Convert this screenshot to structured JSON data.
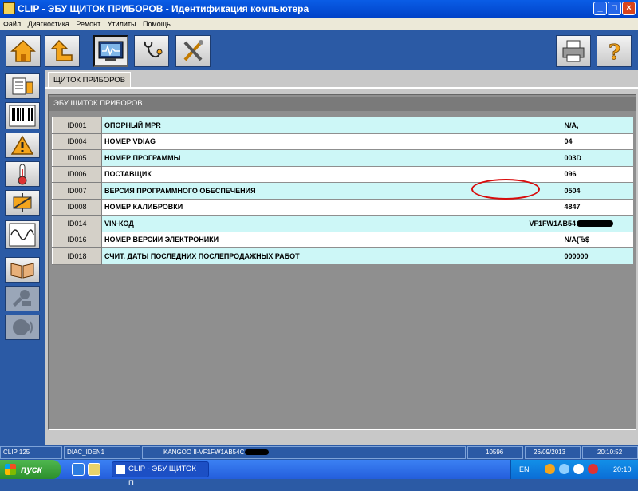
{
  "window": {
    "title": "CLIP - ЭБУ ЩИТОК ПРИБОРОВ - Идентификация компьютера",
    "min": "_",
    "max": "□",
    "close": "×"
  },
  "menu": [
    "Файл",
    "Диагностика",
    "Ремонт",
    "Утилиты",
    "Помощь"
  ],
  "toolbar": {
    "buttons": [
      "home-icon",
      "back-icon",
      "monitor-icon",
      "stethoscope-icon",
      "tools-icon",
      "printer-icon",
      "help-icon"
    ]
  },
  "sidebar": {
    "buttons": [
      "documents-icon",
      "barcode-icon",
      "warning-icon",
      "thermometer-icon",
      "actuator-icon",
      "oscilloscope-icon",
      "manual-icon",
      "repair-icon",
      "voice-icon"
    ]
  },
  "tab": {
    "label": "ЩИТОК ПРИБОРОВ"
  },
  "section": {
    "title": "ЭБУ ЩИТОК ПРИБОРОВ"
  },
  "rows": [
    {
      "id": "ID001",
      "label": "ОПОРНЫЙ MPR",
      "value": "N/A,"
    },
    {
      "id": "ID004",
      "label": "НОМЕР VDIAG",
      "value": "04"
    },
    {
      "id": "ID005",
      "label": "НОМЕР ПРОГРАММЫ",
      "value": "003D"
    },
    {
      "id": "ID006",
      "label": "ПОСТАВЩИК",
      "value": "096"
    },
    {
      "id": "ID007",
      "label": "ВЕРСИЯ ПРОГРАММНОГО ОБЕСПЕЧЕНИЯ",
      "value": "0504"
    },
    {
      "id": "ID008",
      "label": "НОМЕР КАЛИБРОВКИ",
      "value": "4847"
    },
    {
      "id": "ID014",
      "label": "VIN-КОД",
      "value": "VF1FW1AB54"
    },
    {
      "id": "ID016",
      "label": "НОМЕР ВЕРСИИ ЭЛЕКТРОНИКИ",
      "value": "N/A(Ђ$"
    },
    {
      "id": "ID018",
      "label": "СЧИТ. ДАТЫ ПОСЛЕДНИХ ПОСЛЕПРОДАЖНЫХ РАБОТ",
      "value": "000000"
    }
  ],
  "status": {
    "app": "CLIP 125",
    "screen": "DIAC_IDEN1",
    "vehicle": "KANGOO II-VF1FW1AB54C",
    "code": "10596",
    "date": "26/09/2013",
    "time": "20:10:52"
  },
  "taskbar": {
    "start": "пуск",
    "task": "CLIP - ЭБУ ЩИТОК П...",
    "lang": "EN",
    "clock": "20:10"
  },
  "colors": {
    "background": "#2b5aa5",
    "row_alt": "#cdf7f7",
    "highlight": "#d80c0c"
  }
}
